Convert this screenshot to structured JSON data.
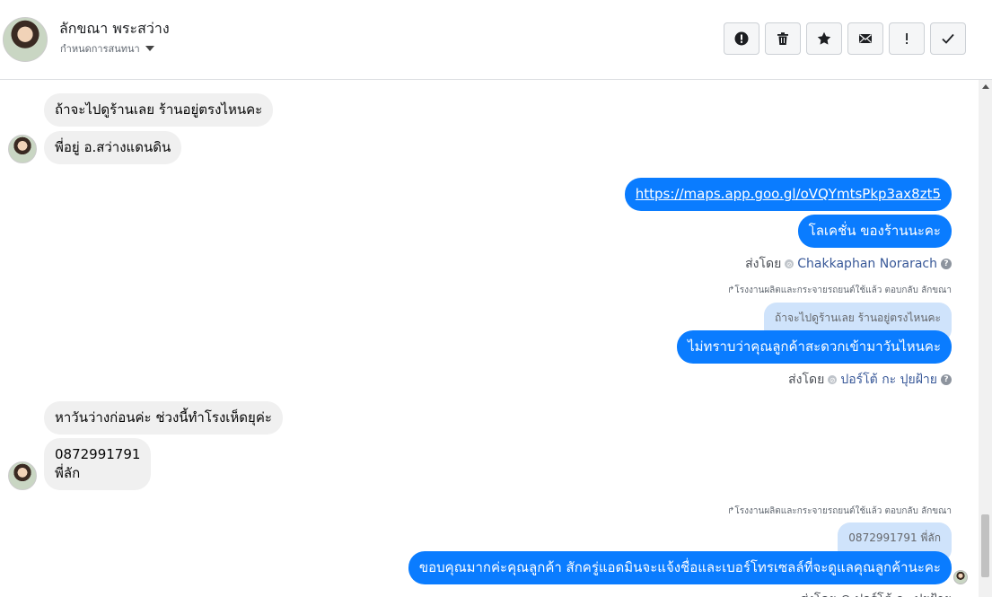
{
  "header": {
    "name": "ลักขณา พระสว่าง",
    "sub_label": "กำหนดการสนทนา"
  },
  "toolbar": {
    "buttons": [
      {
        "name": "report-button",
        "icon": "alert-icon"
      },
      {
        "name": "delete-button",
        "icon": "trash-icon"
      },
      {
        "name": "star-button",
        "icon": "star-icon"
      },
      {
        "name": "mail-button",
        "icon": "envelope-icon"
      },
      {
        "name": "important-button",
        "icon": "exclamation-icon"
      },
      {
        "name": "done-button",
        "icon": "check-icon"
      }
    ]
  },
  "messages": {
    "m1": "ถ้าจะไปดูร้านเลย ร้านอยู่ตรงไหนคะ",
    "m2": "พี่อยู่  อ.สว่างแดนดิน",
    "m3": "https://maps.app.goo.gl/oVQYmtsPkp3ax8zt5",
    "m4": "โลเคชั่น ของร้านนะคะ",
    "sent1_prefix": "ส่งโดย",
    "sent1_name": "Chakkaphan Norarach",
    "reply1": "โรงงานผลิตและกระจายรถยนต์ใช้แล้ว ตอบกลับ ลักขณา",
    "quote1": "ถ้าจะไปดูร้านเลย ร้านอยู่ตรงไหนคะ",
    "m5": "ไม่ทราบว่าคุณลูกค้าสะดวกเข้ามาวันไหนคะ",
    "sent2_prefix": "ส่งโดย",
    "sent2_name": "ปอร์โต้ กะ ปุยฝ้าย",
    "m6": "หาวันว่างก่อนค่ะ ช่วงนี้ทำโรงเห็ดยุค่ะ",
    "m7_line1": "0872991791",
    "m7_line2": "พี่ลัก",
    "reply2": "โรงงานผลิตและกระจายรถยนต์ใช้แล้ว ตอบกลับ ลักขณา",
    "quote2": "0872991791 พี่ลัก",
    "m8": "ขอบคุณมากค่ะคุณลูกค้า สักครู่แอดมินจะแจ้งชื่อและเบอร์โทรเซลล์ที่จะดูแลคุณลูกค้านะคะ",
    "sent3": "ส่งโดย ⊘ ปอร์โต้ กะ ปุยฝ้าย"
  }
}
